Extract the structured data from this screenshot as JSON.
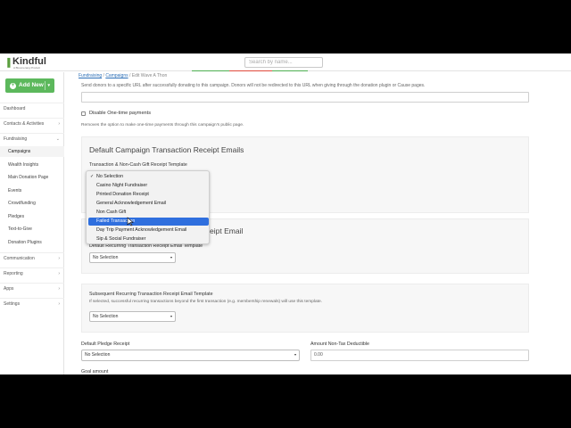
{
  "topbar": {
    "logo_name": "Kindful",
    "logo_tagline": "A Bloomerang Product",
    "search_placeholder": "Search by name..."
  },
  "sidebar": {
    "add_new_label": "Add New",
    "items": [
      {
        "label": "Dashboard"
      },
      {
        "label": "Contacts & Activities"
      },
      {
        "label": "Fundraising"
      },
      {
        "label": "Campaigns"
      },
      {
        "label": "Wealth Insights"
      },
      {
        "label": "Main Donation Page"
      },
      {
        "label": "Events"
      },
      {
        "label": "Crowdfunding"
      },
      {
        "label": "Pledges"
      },
      {
        "label": "Text-to-Give"
      },
      {
        "label": "Donation Plugins"
      },
      {
        "label": "Communication"
      },
      {
        "label": "Reporting"
      },
      {
        "label": "Apps"
      },
      {
        "label": "Settings"
      }
    ]
  },
  "breadcrumb": {
    "fundraising": "Fundraising",
    "campaigns": "Campaigns",
    "current": "Edit Wave A Thon",
    "separator": "/"
  },
  "main": {
    "redirect_help": "Send donors to a specific URL after successfully donating to this campaign. Donors will not be redirected to this URL when giving through the donation plugin or Cause pages.",
    "disable_one_time_label": "Disable One-time payments",
    "disable_one_time_help": "Removes the option to make one-time payments through this campaign's public page.",
    "receipt_section_title": "Default Campaign Transaction Receipt Emails",
    "receipt_template_label": "Transaction & Non-Cash Gift Receipt Template",
    "recurring_section_title_partial": "eipt Email",
    "recurring_first_label": "Default Recurring Transaction Receipt Email Template",
    "recurring_first_value": "No Selection",
    "subsequent_label": "Subsequent Recurring Transaction Receipt Email Template",
    "subsequent_help": "If selected, successful recurring transactions beyond the first transaction (e.g. membership renewals) will use this template.",
    "subsequent_value": "No Selection",
    "pledge_receipt_label": "Default Pledge Receipt",
    "pledge_receipt_value": "No Selection",
    "non_tax_label": "Amount Non-Tax Deductible",
    "non_tax_value": "0.00",
    "goal_label": "Goal amount"
  },
  "dropdown": {
    "options": [
      {
        "label": "No Selection",
        "checked": true
      },
      {
        "label": "Casino Night Fundraiser"
      },
      {
        "label": "Printed Donation Receipt"
      },
      {
        "label": "General Acknowledgement Email"
      },
      {
        "label": "Non Cash Gift"
      },
      {
        "label": "Failed Transaction",
        "highlighted": true
      },
      {
        "label": "Day Trip Payment Acknowledgement Email"
      },
      {
        "label": "Sip & Social Fundraiser"
      }
    ],
    "check_glyph": "✓"
  },
  "colors": {
    "brand_green": "#5cb85c",
    "link_blue": "#2c6fb7",
    "highlight_blue": "#2f6fde"
  }
}
